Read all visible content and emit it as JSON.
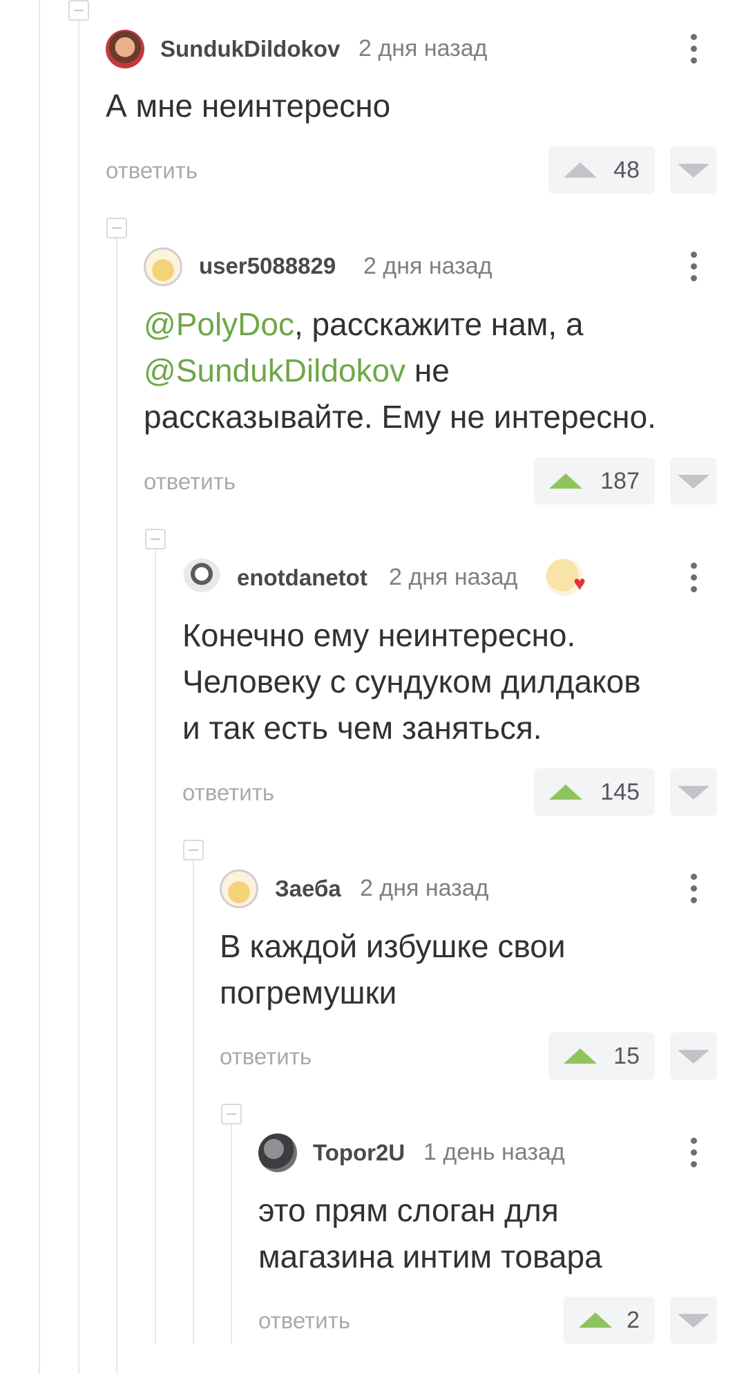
{
  "reply_label": "ответить",
  "colors": {
    "accent_green": "#6ea746",
    "vote_green": "#8fc35c",
    "vote_grey": "#c3c4c8"
  },
  "comments": [
    {
      "user": "SundukDildokov",
      "time": "2 дня назад",
      "lines": [
        "А мне неинтересно"
      ],
      "rating": "48",
      "avatar_icon": "user-photo-avatar"
    },
    {
      "user": "user5088829",
      "time": "2 дня назад",
      "mention_1": "@PolyDoc",
      "text_1": ", расскажите нам, а",
      "mention_2": "@SundukDildokov",
      "text_2": " не",
      "text_3": "рассказывайте. Ему не интересно.",
      "rating": "187",
      "avatar_icon": "default-smiley-avatar"
    },
    {
      "user": "enotdanetot",
      "time": "2 дня назад",
      "lines": [
        "Конечно ему неинтересно.",
        "Человеку с сундуком дилдаков",
        "и так есть чем заняться."
      ],
      "rating": "145",
      "avatar_icon": "raccoon-avatar",
      "badge_icon": "heart-badge-icon"
    },
    {
      "user": "Заеба",
      "time": "2 дня назад",
      "lines": [
        "В каждой избушке свои",
        "погремушки"
      ],
      "rating": "15",
      "avatar_icon": "default-smiley-avatar"
    },
    {
      "user": "Topor2U",
      "time": "1 день назад",
      "lines": [
        "это прям слоган для",
        "магазина интим товара"
      ],
      "rating": "2",
      "avatar_icon": "photo-avatar"
    }
  ]
}
